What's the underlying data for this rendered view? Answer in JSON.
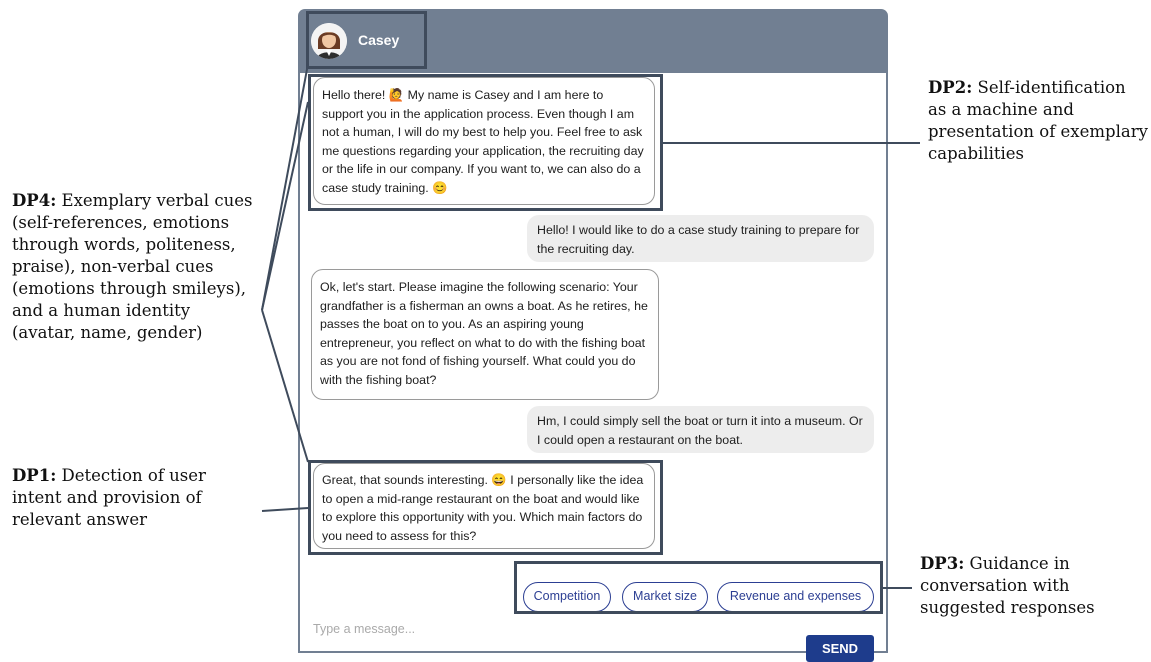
{
  "chat": {
    "bot_name": "Casey",
    "messages": [
      {
        "from": "bot",
        "text": "Hello there! 🙋 My name is Casey and I am here to support you in the application process. Even though I am not a human, I will do my best to help you. Feel free to ask me questions regarding your application, the recruiting day or the life in our company. If you want to, we can also do a case study training. 😊"
      },
      {
        "from": "user",
        "text": "Hello! I would like to do a case study training to prepare for the recruiting day."
      },
      {
        "from": "bot",
        "text": "Ok, let's start. Please imagine the following scenario: Your grandfather is a fisherman an owns a boat. As he retires, he passes the boat on to you. As an aspiring young entrepreneur, you reflect on what to do with the fishing boat as you are not fond of fishing yourself. What could you do with the fishing boat?"
      },
      {
        "from": "user",
        "text": "Hm, I could simply sell the boat or turn it into a museum. Or I could open a restaurant on the boat."
      },
      {
        "from": "bot",
        "text": "Great, that sounds interesting. 😄 I personally like the idea to open a mid-range restaurant on the boat and would like to explore this opportunity with you. Which main factors do you need to assess for this?"
      }
    ],
    "suggestions": [
      "Competition",
      "Market size",
      "Revenue and expenses"
    ],
    "input_placeholder": "Type a message...",
    "send_label": "SEND"
  },
  "annotations": {
    "dp1": {
      "label": "DP1:",
      "text": "Detection of user intent and provision of relevant answer"
    },
    "dp2": {
      "label": "DP2:",
      "text": "Self-identification as a machine and presentation of exemplary capabilities"
    },
    "dp3": {
      "label": "DP3:",
      "text": "Guidance in conversation with suggested responses"
    },
    "dp4": {
      "label": "DP4:",
      "text": "Exemplary verbal cues (self-references, emotions through words, politeness, praise), non-verbal cues (emotions through smileys), and a human identity (avatar, name, gender)"
    }
  },
  "colors": {
    "header": "#717f92",
    "highlight": "#3f4b5c",
    "suggestion": "#2c3f93",
    "send": "#1e3c8c"
  }
}
